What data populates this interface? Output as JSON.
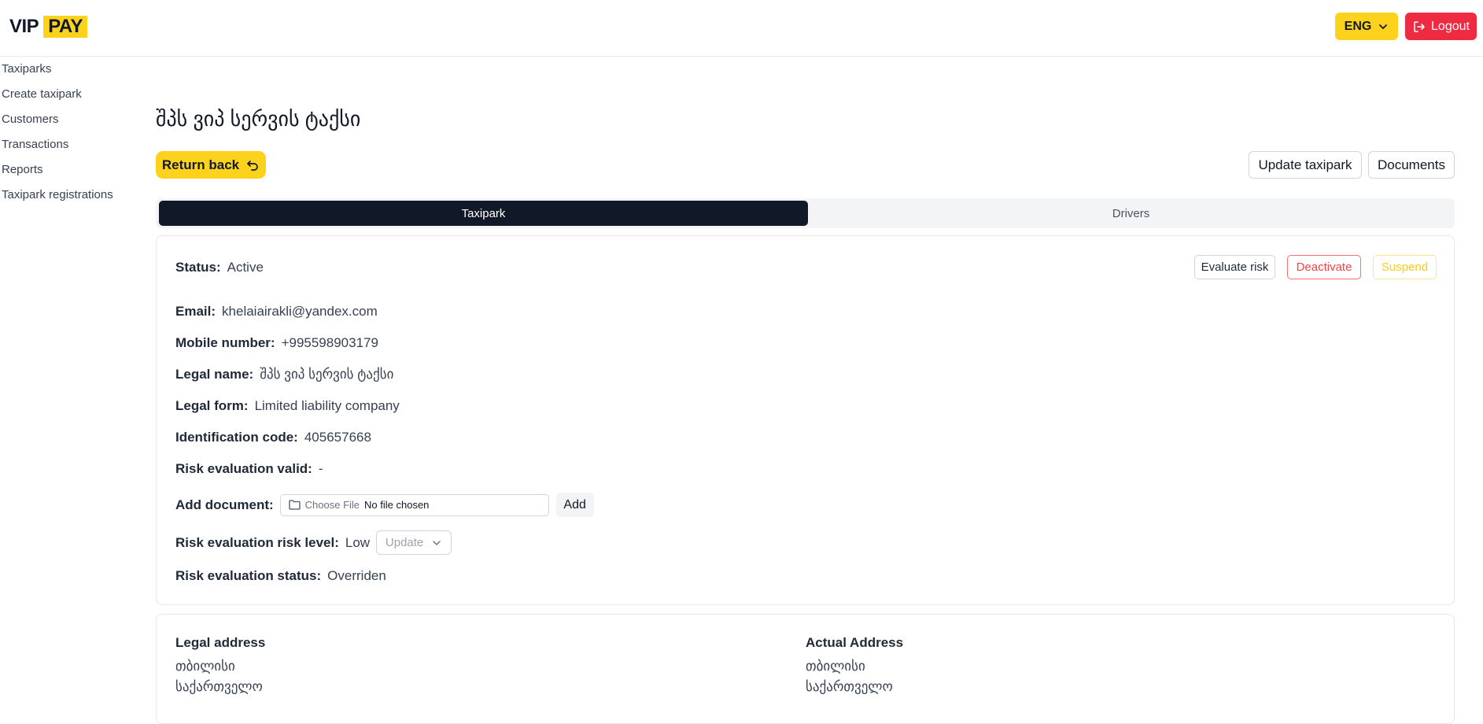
{
  "header": {
    "logo_vip": "VIP",
    "logo_pay": "PAY",
    "language": "ENG",
    "logout_label": "Logout"
  },
  "sidebar": {
    "items": [
      {
        "label": "Taxiparks"
      },
      {
        "label": "Create taxipark"
      },
      {
        "label": "Customers"
      },
      {
        "label": "Transactions"
      },
      {
        "label": "Reports"
      },
      {
        "label": "Taxipark registrations"
      }
    ]
  },
  "page": {
    "title": "შპს ვიპ სერვის ტაქსი",
    "return_label": "Return back",
    "update_taxipark_label": "Update taxipark",
    "documents_label": "Documents"
  },
  "tabs": [
    {
      "label": "Taxipark",
      "active": true
    },
    {
      "label": "Drivers",
      "active": false
    }
  ],
  "details": {
    "status_label": "Status:",
    "status_value": "Active",
    "evaluate_risk_label": "Evaluate risk",
    "deactivate_label": "Deactivate",
    "suspend_label": "Suspend",
    "email_label": "Email:",
    "email_value": "khelaiairakli@yandex.com",
    "mobile_label": "Mobile number:",
    "mobile_value": "+995598903179",
    "legal_name_label": "Legal name:",
    "legal_name_value": "შპს ვიპ სერვის ტაქსი",
    "legal_form_label": "Legal form:",
    "legal_form_value": "Limited liability company",
    "id_code_label": "Identification code:",
    "id_code_value": "405657668",
    "risk_valid_label": "Risk evaluation valid:",
    "risk_valid_value": "-",
    "add_document_label": "Add document:",
    "file_choose_label": "Choose File",
    "file_status": "No file chosen",
    "add_button_label": "Add",
    "risk_level_label": "Risk evaluation risk level:",
    "risk_level_value": "Low",
    "risk_level_select": "Update",
    "risk_status_label": "Risk evaluation status:",
    "risk_status_value": "Overriden"
  },
  "addresses": {
    "legal_title": "Legal address",
    "legal_lines": [
      "თბილისი",
      "საქართველო"
    ],
    "actual_title": "Actual Address",
    "actual_lines": [
      "თბილისი",
      "საქართველო"
    ]
  },
  "colors": {
    "brand_yellow": "#fcd21d",
    "logout_red": "#ef2b43",
    "tab_active_bg": "#111827",
    "deactivate_red": "#ef4444",
    "suspend_yellow": "#facc15"
  }
}
